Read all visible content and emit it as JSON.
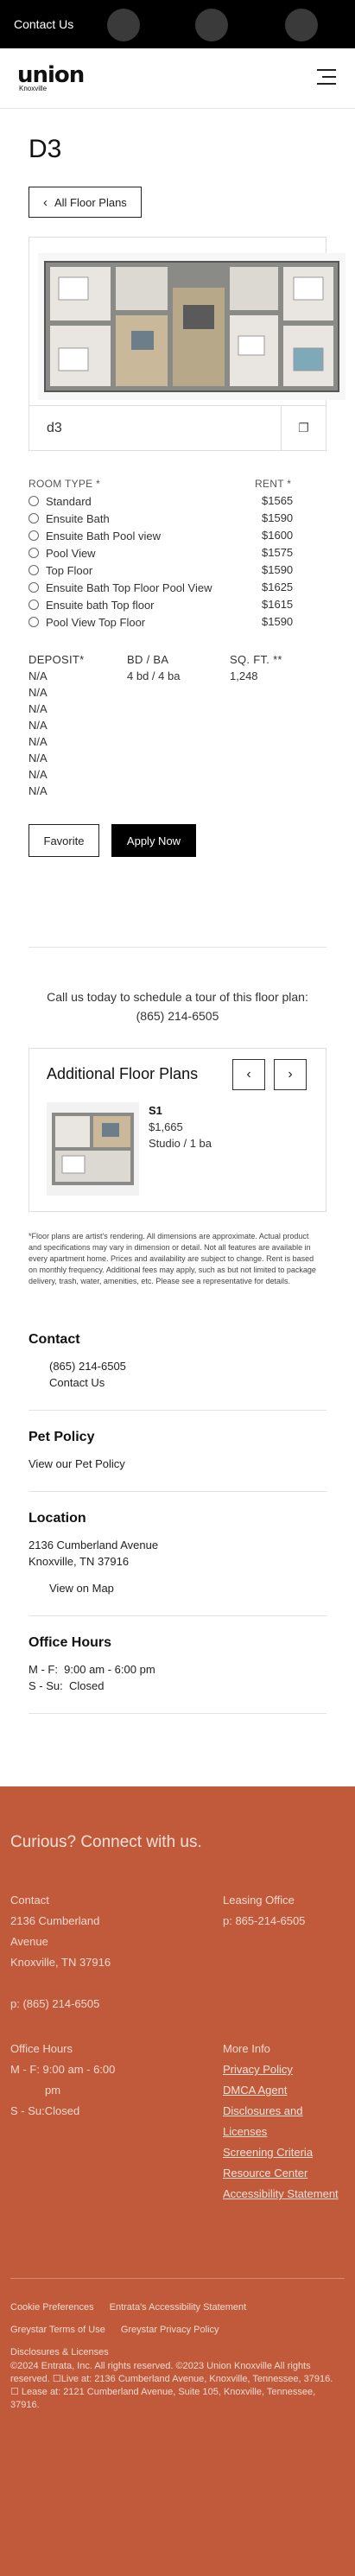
{
  "topbar": {
    "contact_label": "Contact Us"
  },
  "brand": {
    "name": "union",
    "location": "Knoxville"
  },
  "plan": {
    "title": "D3",
    "back_label": "All Floor Plans",
    "image_label": "d3",
    "room_type_label": "ROOM TYPE *",
    "rent_label": "RENT *",
    "room_types": [
      {
        "name": "Standard",
        "rent": "$1565"
      },
      {
        "name": "Ensuite Bath",
        "rent": "$1590"
      },
      {
        "name": "Ensuite Bath Pool view",
        "rent": "$1600"
      },
      {
        "name": "Pool View",
        "rent": "$1575"
      },
      {
        "name": "Top Floor",
        "rent": "$1590"
      },
      {
        "name": "Ensuite Bath Top Floor Pool View",
        "rent": "$1625"
      },
      {
        "name": "Ensuite bath Top floor",
        "rent": "$1615"
      },
      {
        "name": "Pool View Top Floor",
        "rent": "$1590"
      }
    ],
    "deposit_label": "DEPOSIT*",
    "bdba_label": "BD / BA",
    "sqft_label": "SQ. FT. **",
    "deposits": [
      "N/A",
      "N/A",
      "N/A",
      "N/A",
      "N/A",
      "N/A",
      "N/A",
      "N/A"
    ],
    "bdba": "4 bd / 4 ba",
    "sqft": "1,248",
    "favorite_label": "Favorite",
    "apply_label": "Apply Now"
  },
  "call": {
    "line1": "Call us today to schedule a tour of this floor plan:",
    "phone": "(865) 214-6505"
  },
  "additional": {
    "title": "Additional Floor Plans",
    "prev_icon": "chevron-left-icon",
    "next_icon": "chevron-right-icon",
    "item": {
      "name": "S1",
      "price": "$1,665",
      "beds": "Studio / 1 ba"
    }
  },
  "disclaimer": "*Floor plans are artist's rendering. All dimensions are approximate. Actual product and specifications may vary in dimension or detail. Not all features are available in every apartment home. Prices and availability are subject to change. Rent is based on monthly frequency. Additional fees may apply, such as but not limited to package delivery, trash, water, amenities, etc. Please see a representative for details.",
  "contact": {
    "title": "Contact",
    "phone": "(865) 214-6505",
    "link": "Contact Us"
  },
  "pet": {
    "title": "Pet Policy",
    "link": "View our Pet Policy"
  },
  "location": {
    "title": "Location",
    "address1": "2136 Cumberland Avenue",
    "address2": "Knoxville, TN 37916",
    "map_link": "View on Map"
  },
  "hours": {
    "title": "Office Hours",
    "weekday": "M - F:  9:00 am - 6:00 pm",
    "weekend": "S - Su:  Closed"
  },
  "footer": {
    "title": "Curious? Connect with us.",
    "contact_head": "Contact",
    "address_a": "2136 Cumberland",
    "address_b": "Avenue",
    "address_c": "Knoxville, TN 37916",
    "phone": "p: (865) 214-6505",
    "leasing_head": "Leasing Office",
    "leasing_phone": "p: 865-214-6505",
    "hours_head": "Office Hours",
    "hours_a": "M - F: 9:00 am - 6:00",
    "hours_b": "pm",
    "hours_c": "S - Su:Closed",
    "more_head": "More Info",
    "more_links": [
      "Privacy Policy",
      "DMCA Agent",
      "Disclosures and Licenses",
      "Screening Criteria",
      "Resource Center",
      "Accessibility Statement"
    ],
    "bottom_links": [
      "Cookie Preferences",
      "Entrata's Accessibility Statement",
      "Greystar Terms of Use",
      "Greystar Privacy Policy",
      "Disclosures & Licenses"
    ],
    "legal": "©2024 Entrata, Inc. All rights reserved. ©2023 Union Knoxville All rights reserved. ☐Live at: 2136 Cumberland Avenue, Knoxville, Tennessee, 37916. ☐ Lease at: 2121 Cumberland Avenue, Suite 105, Knoxville, Tennessee, 37916.",
    "accent_color": "#c05a3a"
  }
}
